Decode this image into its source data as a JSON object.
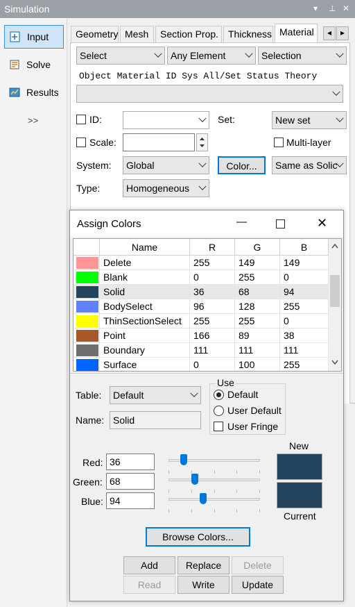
{
  "window": {
    "title": "Simulation",
    "controls": [
      "▾",
      "⊿",
      "✕"
    ]
  },
  "nav": {
    "items": [
      {
        "label": "Input",
        "icon": "input-icon",
        "active": true
      },
      {
        "label": "Solve",
        "icon": "solve-icon",
        "active": false
      },
      {
        "label": "Results",
        "icon": "results-icon",
        "active": false
      }
    ],
    "expand": ">>"
  },
  "tabs": {
    "items": [
      "Geometry",
      "Mesh",
      "Section Prop.",
      "Thickness",
      "Material"
    ],
    "active": "Material",
    "prev": "◂",
    "next": "▸"
  },
  "material": {
    "select_combo": "Select",
    "element_combo": "Any Element",
    "selection_combo": "Selection",
    "columns_header": "Object  Material ID  Sys All/Set  Status   Theory",
    "object_combo": "",
    "id_label": "ID:",
    "id_value": "",
    "set_label": "Set:",
    "set_value": "New set",
    "scale_label": "Scale:",
    "scale_value": "",
    "multilayer_label": "Multi-layer",
    "system_label": "System:",
    "system_value": "Global",
    "color_button": "Color...",
    "same_as_value": "Same as Solic",
    "type_label": "Type:",
    "type_value": "Homogeneous"
  },
  "dialog": {
    "title": "Assign Colors",
    "title_controls": {
      "minimize": "—",
      "maximize": "☐",
      "close": "✕"
    },
    "table": {
      "headers": [
        "Name",
        "R",
        "G",
        "B"
      ],
      "rows": [
        {
          "name": "Delete",
          "r": "255",
          "g": "149",
          "b": "149",
          "color": "#ff9595",
          "selected": false
        },
        {
          "name": "Blank",
          "r": "0",
          "g": "255",
          "b": "0",
          "color": "#00ff00",
          "selected": false
        },
        {
          "name": "Solid",
          "r": "36",
          "g": "68",
          "b": "94",
          "color": "#24445e",
          "selected": true
        },
        {
          "name": "BodySelect",
          "r": "96",
          "g": "128",
          "b": "255",
          "color": "#6080ff",
          "selected": false
        },
        {
          "name": "ThinSectionSelect",
          "r": "255",
          "g": "255",
          "b": "0",
          "color": "#ffff00",
          "selected": false
        },
        {
          "name": "Point",
          "r": "166",
          "g": "89",
          "b": "38",
          "color": "#a65926",
          "selected": false
        },
        {
          "name": "Boundary",
          "r": "111",
          "g": "111",
          "b": "111",
          "color": "#6f6f6f",
          "selected": false
        },
        {
          "name": "Surface",
          "r": "0",
          "g": "100",
          "b": "255",
          "color": "#0064ff",
          "selected": false
        }
      ]
    },
    "table_label": "Table:",
    "table_value": "Default",
    "name_label": "Name:",
    "name_value": "Solid",
    "use_group": {
      "title": "Use",
      "default": "Default",
      "user_default": "User Default",
      "user_fringe": "User Fringe",
      "selected": "Default"
    },
    "red_label": "Red:",
    "red_value": "36",
    "green_label": "Green:",
    "green_value": "68",
    "blue_label": "Blue:",
    "blue_value": "94",
    "slider_levels": {
      "red": 0.14,
      "green": 0.27,
      "blue": 0.37
    },
    "new_label": "New",
    "current_label": "Current",
    "new_color": "#24445e",
    "current_color": "#24445e",
    "browse_button": "Browse Colors...",
    "buttons": {
      "add": "Add",
      "replace": "Replace",
      "delete": "Delete",
      "read": "Read",
      "write": "Write",
      "update": "Update"
    }
  }
}
